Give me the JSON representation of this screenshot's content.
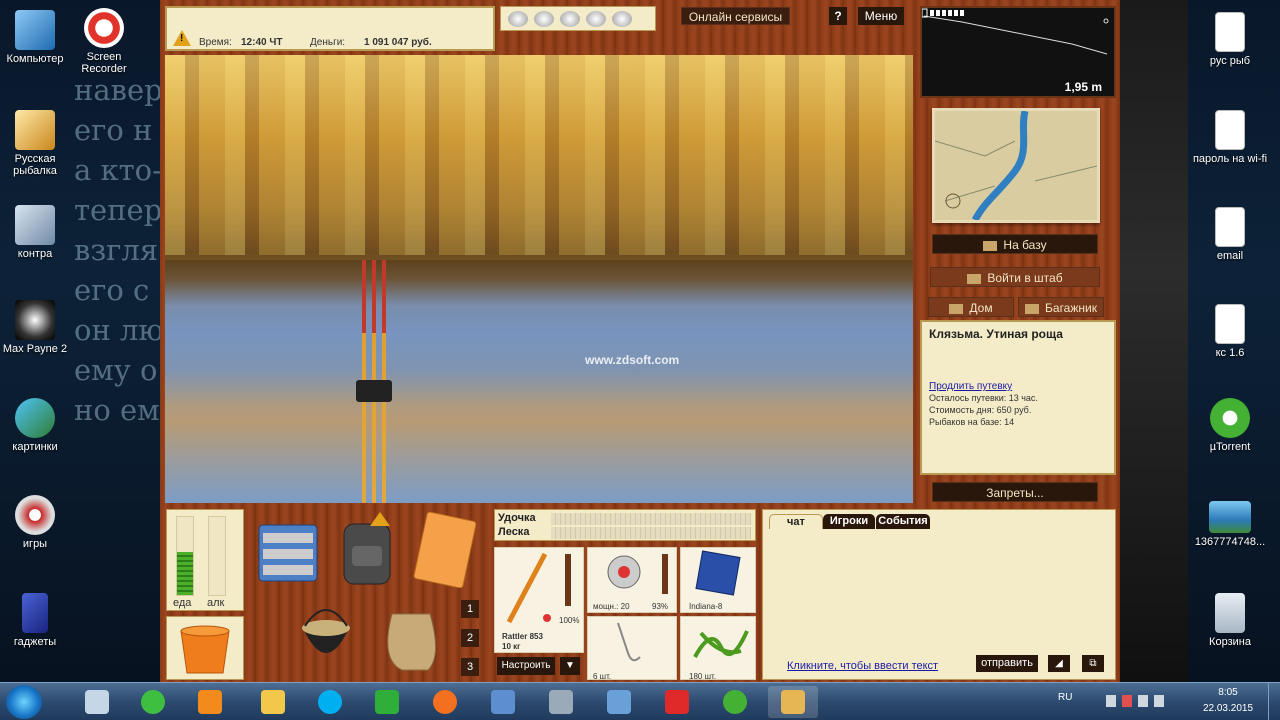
{
  "desktop": {
    "bg_text": [
      "навер",
      "его н",
      "а кто-",
      "тепер",
      "взгля",
      "его с",
      "он лю",
      "ему о",
      "но ем"
    ],
    "left_icons": [
      {
        "label": "Компьютер",
        "icon": "computer-icon"
      },
      {
        "label": "Screen Recorder",
        "icon": "screen-recorder-icon"
      },
      {
        "label": "Русская рыбалка",
        "icon": "russian-fishing-icon"
      },
      {
        "label": "контра",
        "icon": "counter-strike-icon"
      },
      {
        "label": "Max Payne 2",
        "icon": "max-payne-icon"
      },
      {
        "label": "картинки",
        "icon": "pictures-icon"
      },
      {
        "label": "игры",
        "icon": "games-icon"
      },
      {
        "label": "гаджеты",
        "icon": "gadgets-icon"
      }
    ],
    "right_icons": [
      {
        "label": "рус рыб",
        "icon": "document-icon"
      },
      {
        "label": "пароль на wi-fi",
        "icon": "document-icon"
      },
      {
        "label": "email",
        "icon": "document-icon"
      },
      {
        "label": "кс 1.6",
        "icon": "document-icon"
      },
      {
        "label": "µTorrent",
        "icon": "utorrent-icon"
      },
      {
        "label": "1367774748...",
        "icon": "image-file-icon"
      },
      {
        "label": "Корзина",
        "icon": "recycle-bin-icon"
      }
    ]
  },
  "game": {
    "status": {
      "time_label": "Время:",
      "time_value": "12:40 ЧТ",
      "money_label": "Деньги:",
      "money_value": "1 091 047 руб."
    },
    "top_buttons": {
      "online": "Онлайн сервисы",
      "help": "?",
      "menu": "Меню"
    },
    "scene": {
      "watermark": "www.zdsoft.com"
    },
    "sonar": {
      "depth": "1,95 m"
    },
    "nav": {
      "base": "На базу",
      "hq": "Войти в штаб",
      "home": "Дом",
      "trunk": "Багажник",
      "bans": "Запреты..."
    },
    "info": {
      "place": "Клязьма. Утиная роща",
      "extend_link": "Продлить путевку",
      "remaining": "Осталось путевки: 13 час.",
      "day_cost": "Стоимость дня: 650 руб.",
      "fishers": "Рыбаков на базе: 14"
    },
    "needs": {
      "food_label": "еда",
      "alcohol_label": "алк",
      "food_level": 0.55,
      "alcohol_level": 0
    },
    "inventory_numbers": [
      "1",
      "2",
      "3"
    ],
    "tackle": {
      "rod_label": "Удочка",
      "line_label": "Леска",
      "rod_name": "Rattler 853",
      "rod_weight": "10 кг",
      "rod_pct": "100%",
      "reel_power": "мощн.: 20",
      "reel_pct": "93%",
      "lure_name": "Indiana-8",
      "hooks_count": "6 шт.",
      "bait_count": "180 шт.",
      "setup_button": "Настроить",
      "dropdown_arrow": "▼"
    },
    "chat": {
      "tabs": [
        "чат",
        "Игроки",
        "События"
      ],
      "hint": "Кликните, чтобы ввести текст",
      "send": "отправить"
    }
  },
  "taskbar": {
    "lang": "RU",
    "time": "8:05",
    "date": "22.03.2015"
  }
}
